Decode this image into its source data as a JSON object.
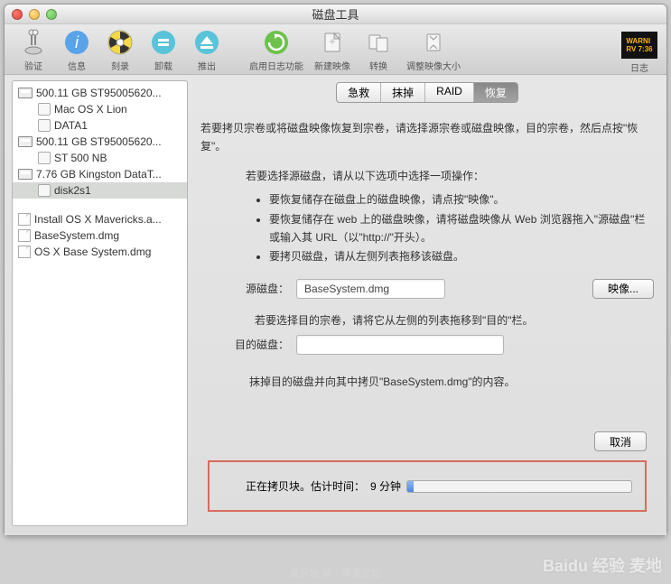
{
  "window": {
    "title": "磁盘工具"
  },
  "toolbar": {
    "items": [
      {
        "label": "验证"
      },
      {
        "label": "信息"
      },
      {
        "label": "刻录"
      },
      {
        "label": "卸载"
      },
      {
        "label": "推出"
      },
      {
        "label": "启用日志功能"
      },
      {
        "label": "新建映像"
      },
      {
        "label": "转换"
      },
      {
        "label": "调整映像大小"
      }
    ],
    "log_label": "日志"
  },
  "sidebar": {
    "disk1": "500.11 GB ST95005620...",
    "disk1_v1": "Mac OS X Lion",
    "disk1_v2": "DATA1",
    "disk2": "500.11 GB ST95005620...",
    "disk2_v1": "ST 500 NB",
    "disk3": "7.76 GB Kingston DataT...",
    "disk3_v1": "disk2s1",
    "img1": "Install OS X Mavericks.a...",
    "img2": "BaseSystem.dmg",
    "img3": "OS X Base System.dmg"
  },
  "tabs": {
    "t1": "急救",
    "t2": "抹掉",
    "t3": "RAID",
    "t4": "恢复"
  },
  "restore": {
    "intro": "若要拷贝宗卷或将磁盘映像恢复到宗卷，请选择源宗卷或磁盘映像，目的宗卷，然后点按\"恢复\"。",
    "sub_intro": "若要选择源磁盘，请从以下选项中选择一项操作：",
    "b1": "要恢复储存在磁盘上的磁盘映像，请点按\"映像\"。",
    "b2": "要恢复储存在 web 上的磁盘映像，请将磁盘映像从 Web 浏览器拖入\"源磁盘\"栏或输入其 URL（以\"http://\"开头）。",
    "b3": "要拷贝磁盘，请从左侧列表拖移该磁盘。",
    "src_label": "源磁盘：",
    "src_value": "BaseSystem.dmg",
    "image_btn": "映像...",
    "dst_hint": "若要选择目的宗卷，请将它从左侧的列表拖移到\"目的\"栏。",
    "dst_label": "目的磁盘：",
    "erase_note": "抹掉目的磁盘并向其中拷贝\"BaseSystem.dmg\"的内容。",
    "cancel": "取消",
    "progress_prefix": "正在拷贝块。估计时间：",
    "progress_time": "9 分钟"
  },
  "watermark": {
    "brand": "Baidu 经验  麦地",
    "sub": "麦牙地  第一苹果论坛"
  }
}
